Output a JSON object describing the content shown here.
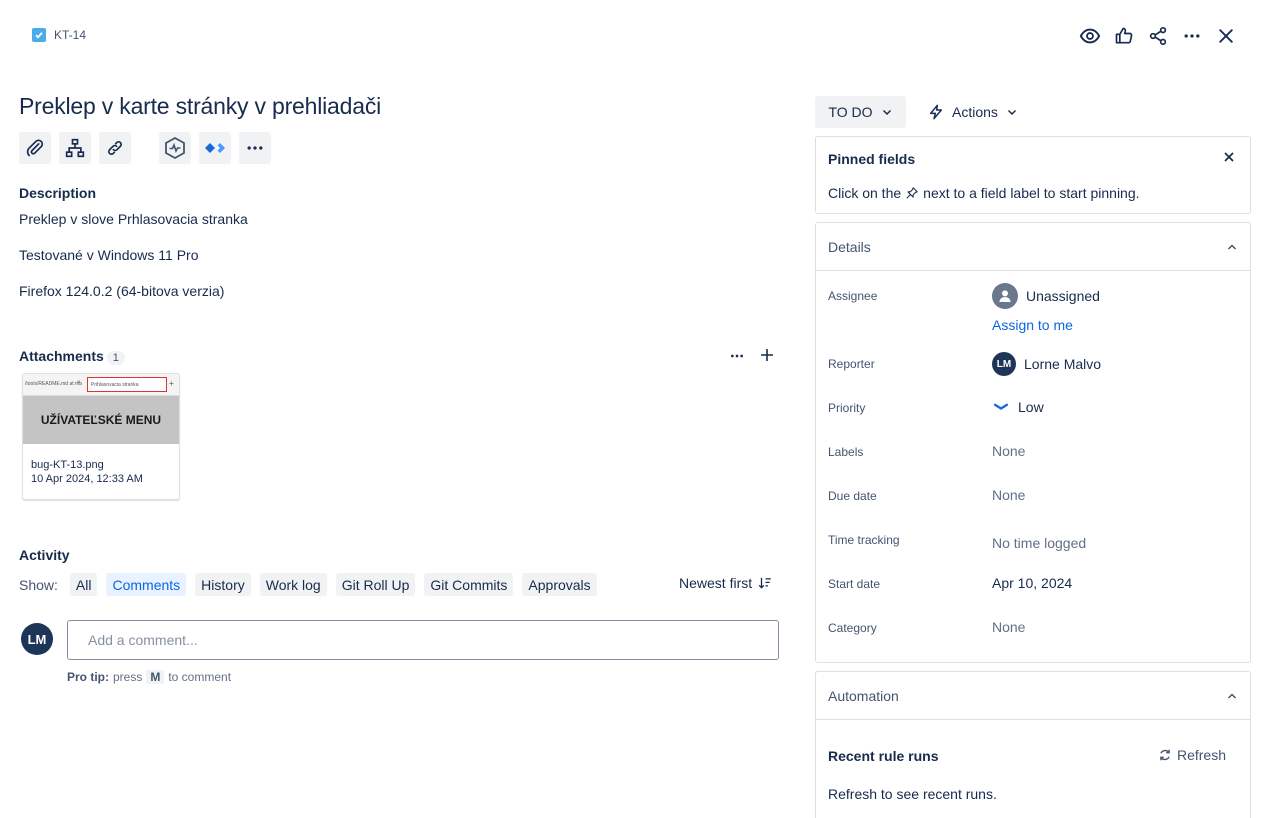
{
  "header": {
    "issue_key": "KT-14"
  },
  "issue": {
    "title": "Preklep v karte stránky v prehliadači"
  },
  "description": {
    "heading": "Description",
    "lines": [
      "Preklep v slove Prhlasovacia stranka",
      "Testované v Windows 11 Pro",
      "Firefox 124.0.2 (64-bitova verzia)"
    ]
  },
  "attachments": {
    "heading": "Attachments",
    "count": "1",
    "items": [
      {
        "thumb_menu_text": "UŽÍVATEĽSKÉ MENU",
        "thumb_tab_text": "Prihlasovacia stranka",
        "thumb_bar_text": "/tools/README.md at ma",
        "file_name": "bug-KT-13.png",
        "date": "10 Apr 2024, 12:33 AM"
      }
    ]
  },
  "activity": {
    "heading": "Activity",
    "show_label": "Show:",
    "filters": [
      "All",
      "Comments",
      "History",
      "Work log",
      "Git Roll Up",
      "Git Commits",
      "Approvals"
    ],
    "selected_filter": "Comments",
    "sort_label": "Newest first",
    "user_initials": "LM",
    "comment_placeholder": "Add a comment...",
    "pro_tip_label": "Pro tip:",
    "pro_tip_press": "press",
    "pro_tip_key": "M",
    "pro_tip_suffix": "to comment"
  },
  "sidebar": {
    "status": "TO DO",
    "actions_label": "Actions",
    "pinned": {
      "title": "Pinned fields",
      "text_before": "Click on the",
      "text_after": "next to a field label to start pinning."
    },
    "details": {
      "title": "Details",
      "fields": {
        "assignee": {
          "label": "Assignee",
          "value": "Unassigned",
          "link": "Assign to me"
        },
        "reporter": {
          "label": "Reporter",
          "value": "Lorne Malvo",
          "initials": "LM"
        },
        "priority": {
          "label": "Priority",
          "value": "Low"
        },
        "labels": {
          "label": "Labels",
          "value": "None"
        },
        "due_date": {
          "label": "Due date",
          "value": "None"
        },
        "time_tracking": {
          "label": "Time tracking",
          "value": "No time logged"
        },
        "start_date": {
          "label": "Start date",
          "value": "Apr 10, 2024"
        },
        "category": {
          "label": "Category",
          "value": "None"
        }
      }
    },
    "automation": {
      "title": "Automation",
      "recent_runs": "Recent rule runs",
      "refresh": "Refresh",
      "empty_text": "Refresh to see recent runs."
    }
  },
  "colors": {
    "accent": "#0c66e4",
    "avatar_bg": "#1d3557",
    "checkbox_bg": "#4bade8"
  }
}
